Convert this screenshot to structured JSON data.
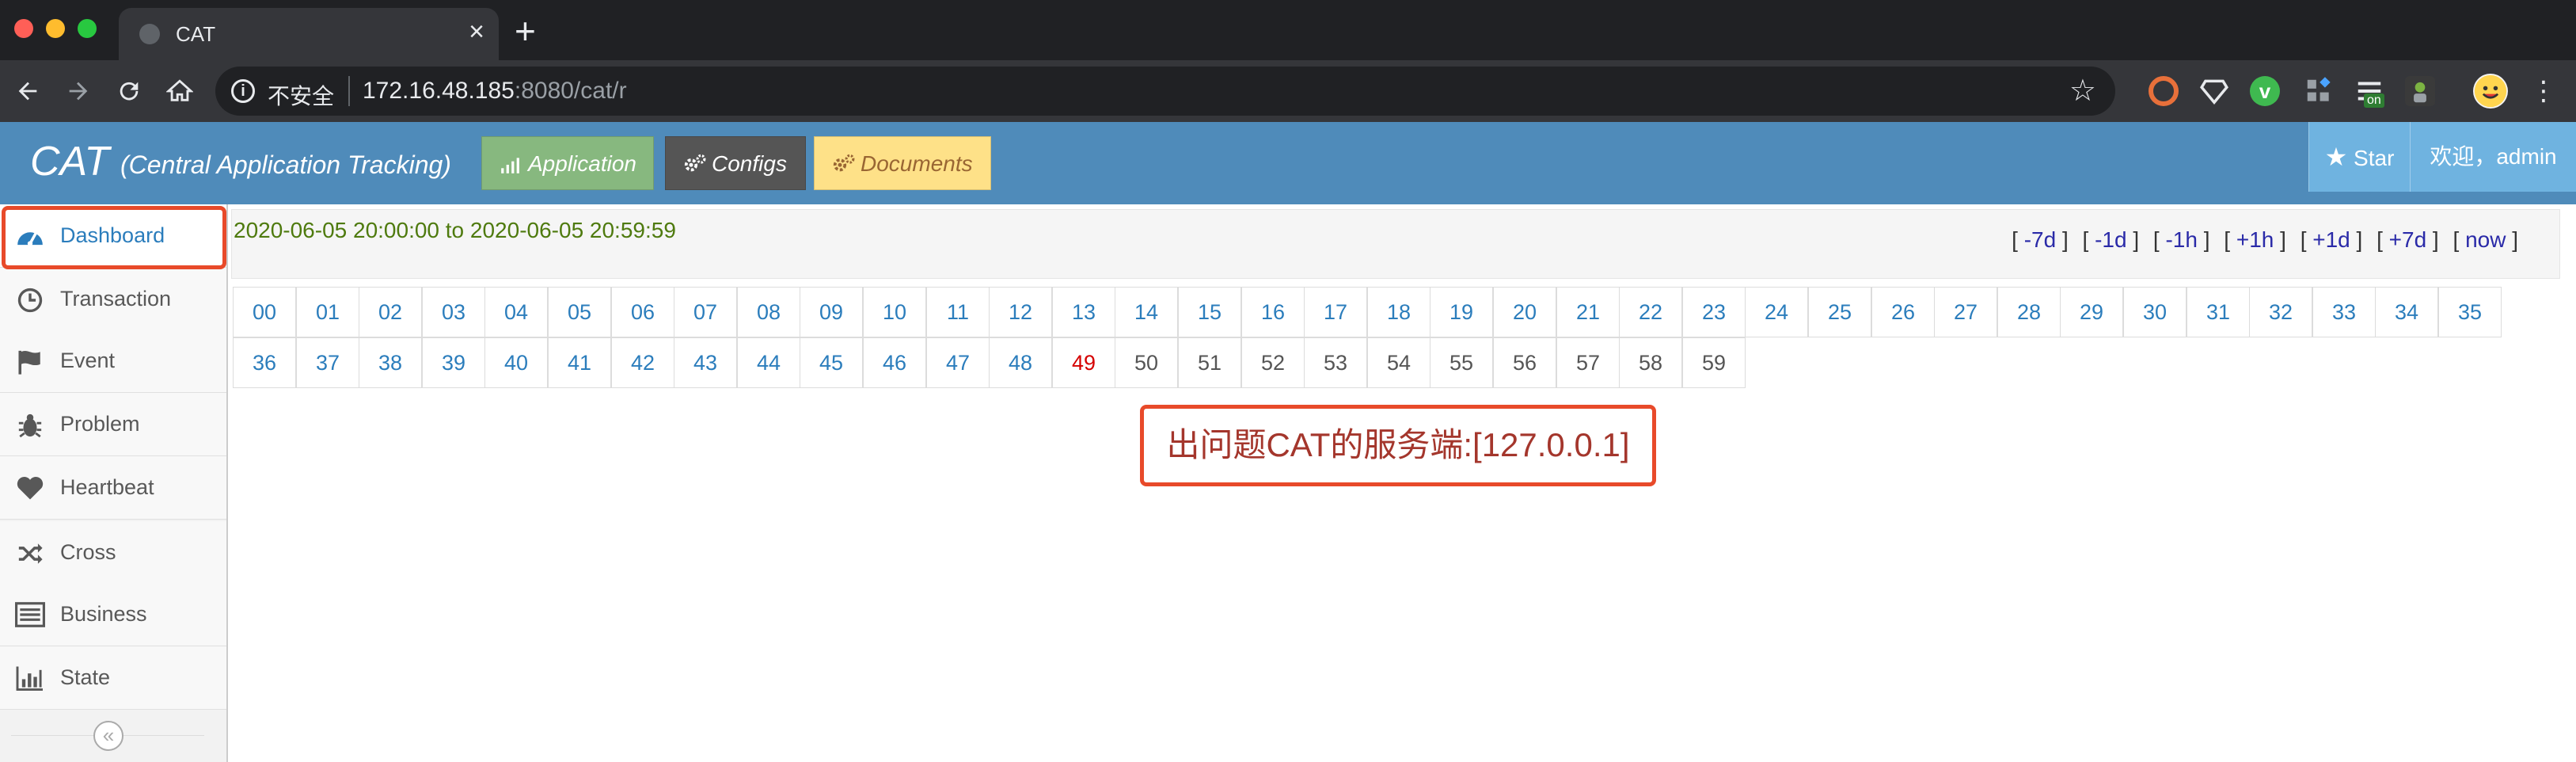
{
  "browser": {
    "tab_title": "CAT",
    "tab_close": "×",
    "new_tab": "+",
    "security_label": "不安全",
    "url_host": "172.16.48.185",
    "url_rest": ":8080/cat/r",
    "ext_badge": "on"
  },
  "header": {
    "brand": "CAT",
    "brand_sub": "(Central Application Tracking)",
    "buttons": {
      "application": "Application",
      "configs": "Configs",
      "documents": "Documents"
    },
    "star_label": "Star",
    "welcome": "欢迎，admin"
  },
  "sidebar": {
    "items": [
      {
        "label": "Dashboard",
        "icon": "dashboard-icon"
      },
      {
        "label": "Transaction",
        "icon": "clock-icon"
      },
      {
        "label": "Event",
        "icon": "flag-icon"
      },
      {
        "label": "Problem",
        "icon": "bug-icon"
      },
      {
        "label": "Heartbeat",
        "icon": "heart-icon"
      },
      {
        "label": "Cross",
        "icon": "shuffle-icon"
      },
      {
        "label": "Business",
        "icon": "list-icon"
      },
      {
        "label": "State",
        "icon": "bar-chart-icon"
      }
    ],
    "active_index": 0,
    "collapse_glyph": "«"
  },
  "time_range": "2020-06-05 20:00:00 to 2020-06-05 20:59:59",
  "nav_links": [
    "-7d",
    "-1d",
    "-1h",
    "+1h",
    "+1d",
    "+7d",
    "now"
  ],
  "minutes": {
    "labels": [
      "00",
      "01",
      "02",
      "03",
      "04",
      "05",
      "06",
      "07",
      "08",
      "09",
      "10",
      "11",
      "12",
      "13",
      "14",
      "15",
      "16",
      "17",
      "18",
      "19",
      "20",
      "21",
      "22",
      "23",
      "24",
      "25",
      "26",
      "27",
      "28",
      "29",
      "30",
      "31",
      "32",
      "33",
      "34",
      "35",
      "36",
      "37",
      "38",
      "39",
      "40",
      "41",
      "42",
      "43",
      "44",
      "45",
      "46",
      "47",
      "48",
      "49",
      "50",
      "51",
      "52",
      "53",
      "54",
      "55",
      "56",
      "57",
      "58",
      "59"
    ],
    "current": "49"
  },
  "error_message": "出问题CAT的服务端:[127.0.0.1]",
  "colors": {
    "header_bg": "#4f8bba",
    "link_blue": "#2b7dbc",
    "current_red": "#d50000",
    "highlight_outline": "#e84a2a"
  }
}
